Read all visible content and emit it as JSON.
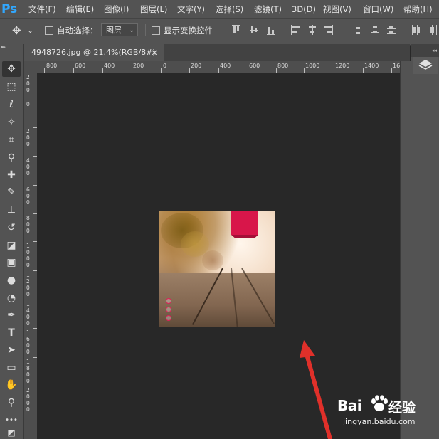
{
  "app": {
    "logo": "Ps",
    "menu": [
      "文件(F)",
      "编辑(E)",
      "图像(I)",
      "图层(L)",
      "文字(Y)",
      "选择(S)",
      "滤镜(T)",
      "3D(D)",
      "视图(V)",
      "窗口(W)",
      "帮助(H)"
    ]
  },
  "options_bar": {
    "move_icon": "✥",
    "dropdown_caret": "⌄",
    "auto_select_label": "自动选择：",
    "auto_select_target": "图层",
    "show_transform_label": "显示变换控件"
  },
  "document": {
    "tab_title": "4948726.jpg @ 21.4%(RGB/8#)",
    "close_glyph": "×"
  },
  "ruler": {
    "top_labels": [
      "800",
      "600",
      "400",
      "200",
      "0",
      "200",
      "400",
      "600",
      "800",
      "1000",
      "1200",
      "1400",
      "16"
    ],
    "left_labels": [
      "2\n0\n0",
      "0",
      "2\n0\n0",
      "4\n0\n0",
      "6\n0\n0",
      "8\n0\n0",
      "1\n0\n0\n0",
      "1\n2\n0\n0",
      "1\n4\n0\n0",
      "1\n6\n0\n0",
      "1\n8\n0\n0",
      "2\n0\n0\n0"
    ]
  },
  "panels": {
    "collapse_glyph": "▸▸",
    "right_collapse_glyph": "◂◂"
  },
  "tools": [
    {
      "name": "move-tool",
      "glyph": "✥"
    },
    {
      "name": "marquee-tool",
      "glyph": "⬚"
    },
    {
      "name": "lasso-tool",
      "glyph": "ℓ"
    },
    {
      "name": "magic-wand-tool",
      "glyph": "✧"
    },
    {
      "name": "crop-tool",
      "glyph": "⌗"
    },
    {
      "name": "eyedropper-tool",
      "glyph": "⚲"
    },
    {
      "name": "healing-brush-tool",
      "glyph": "✚"
    },
    {
      "name": "brush-tool",
      "glyph": "✎"
    },
    {
      "name": "clone-stamp-tool",
      "glyph": "⊥"
    },
    {
      "name": "history-brush-tool",
      "glyph": "↺"
    },
    {
      "name": "eraser-tool",
      "glyph": "◪"
    },
    {
      "name": "gradient-tool",
      "glyph": "▣"
    },
    {
      "name": "blur-tool",
      "glyph": "●"
    },
    {
      "name": "dodge-tool",
      "glyph": "◔"
    },
    {
      "name": "pen-tool",
      "glyph": "✒"
    },
    {
      "name": "type-tool",
      "glyph": "T"
    },
    {
      "name": "path-selection-tool",
      "glyph": "➤"
    },
    {
      "name": "rectangle-tool",
      "glyph": "▭"
    },
    {
      "name": "hand-tool",
      "glyph": "✋"
    },
    {
      "name": "zoom-tool",
      "glyph": "⚲"
    },
    {
      "name": "more-tools",
      "glyph": "•••"
    },
    {
      "name": "color-swatches",
      "glyph": "◩"
    }
  ],
  "watermark": {
    "brand": "Bai",
    "brand_cn": "经验",
    "url": "jingyan.baidu.com"
  },
  "colors": {
    "accent_ps": "#31a8ff",
    "arrow": "#e0302a",
    "ribbon": "#d8164a"
  }
}
